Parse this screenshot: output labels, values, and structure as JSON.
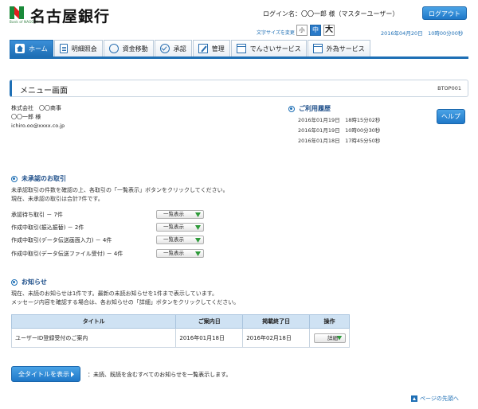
{
  "header": {
    "bank_name": "名古屋銀行",
    "logo_sub": "Bank of NAGOYA",
    "login_label": "ログイン名：〇〇一郎 様（マスターユーザー）",
    "logout_label": "ログアウト",
    "font_size_label": "文字サイズを変更",
    "font_sizes": [
      "小",
      "中",
      "大"
    ],
    "datetime": "2016年04月20日　10時00分00秒"
  },
  "nav": {
    "items": [
      {
        "label": "ホーム",
        "icon": "home-icon"
      },
      {
        "label": "明細照会",
        "icon": "document-icon"
      },
      {
        "label": "資金移動",
        "icon": "transfer-icon"
      },
      {
        "label": "承認",
        "icon": "check-icon"
      },
      {
        "label": "管理",
        "icon": "edit-icon"
      },
      {
        "label": "でんさいサービス",
        "icon": "window-icon"
      },
      {
        "label": "外為サービス",
        "icon": "window-icon"
      }
    ]
  },
  "title": {
    "text": "メニュー画面",
    "code": "BTOP001"
  },
  "user": {
    "company": "株式会社　〇〇商事",
    "name": "〇〇一郎 様",
    "email": "ichiro.oo@xxxx.co.jp"
  },
  "history": {
    "heading": "ご利用履歴",
    "entries": [
      "2016年01月19日　18時15分02秒",
      "2016年01月19日　10時00分30秒",
      "2016年01月18日　17時45分50秒"
    ],
    "help_label": "ヘルプ"
  },
  "pending": {
    "heading": "未承認のお取引",
    "desc1": "未承認取引の件数を確認の上、各取引の「一覧表示」ボタンをクリックしてください。",
    "desc2": "現在、未承認の取引は合計7件です。",
    "button_label": "一覧表示",
    "rows": [
      "承認待ち取引 － 7件",
      "作成中取引(振込振替) － 2件",
      "作成中取引(データ伝送画面入力) － 4件",
      "作成中取引(データ伝送ファイル受付) － 4件"
    ]
  },
  "notice": {
    "heading": "お知らせ",
    "desc1": "現在、未読のお知らせは1件です。最新の未読お知らせを1件まで表示しています。",
    "desc2": "メッセージ内容を確認する場合は、各お知らせの「詳細」ボタンをクリックしてください。",
    "columns": [
      "タイトル",
      "ご案内日",
      "掲載終了日",
      "操作"
    ],
    "rows": [
      {
        "title": "ユーザーID登録受付のご案内",
        "date": "2016年01月18日",
        "end": "2016年02月18日",
        "action": "詳細"
      }
    ],
    "all_button": "全タイトルを表示",
    "all_note": "：未読、既読を含むすべてのお知らせを一覧表示します。"
  },
  "footer": {
    "pagetop": "ページの先頭へ"
  }
}
